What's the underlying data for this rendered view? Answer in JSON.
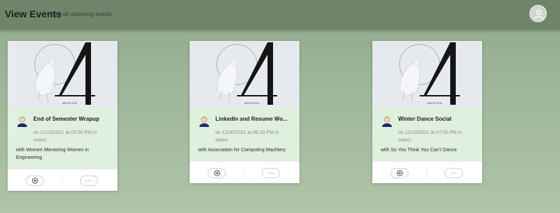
{
  "header": {
    "title": "View Events",
    "subtitle": "View all upcoming events",
    "avatar_icon": "user-avatar-icon"
  },
  "image": {
    "caption": "ARCTIC FOX"
  },
  "events": [
    {
      "title": "End of Semester Wrapup",
      "schedule": "on 11/19/2021 at 05:00 PM in select",
      "host": "with Women Mentoring Women in Engineering",
      "add_icon": "add-circle-icon",
      "more_label": "···"
    },
    {
      "title": "LinkedIn and Resume Wo...",
      "schedule": "on 11/30/2021 at 06:30 PM in select",
      "host": "with Association for Computing Machiery",
      "add_icon": "add-circle-icon",
      "more_label": "···"
    },
    {
      "title": "Winter Dance Social",
      "schedule": "on 12/10/2021 at 07:00 PM in select",
      "host": "with So You Think You Can't Dance",
      "add_icon": "add-circle-icon",
      "more_label": "···"
    }
  ]
}
